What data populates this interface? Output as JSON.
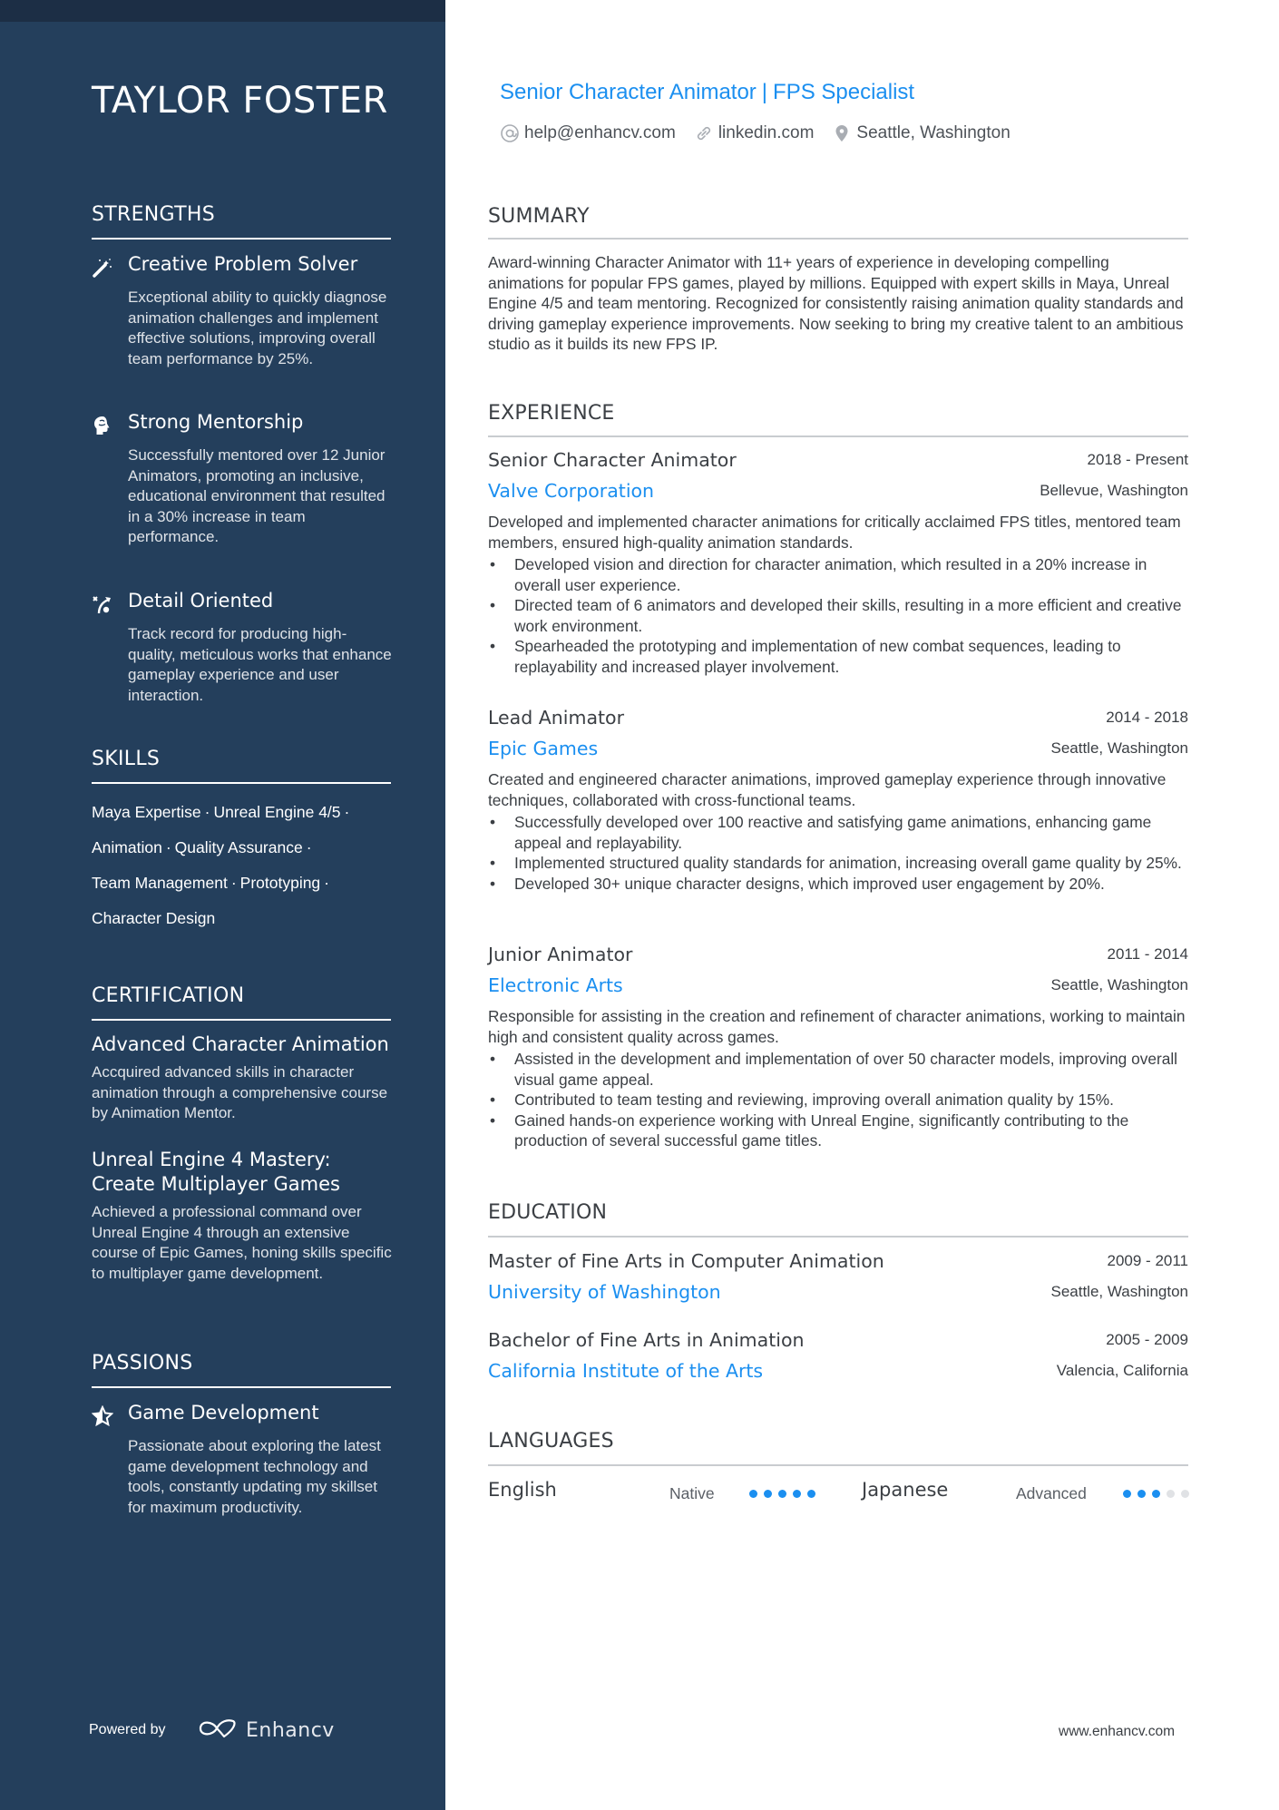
{
  "profile": {
    "name": "TAYLOR FOSTER",
    "headline": "Senior Character Animator",
    "headline_separator": "|",
    "headline_specialty": "FPS Specialist",
    "contacts": [
      {
        "icon": "at-icon",
        "text": "help@enhancv.com"
      },
      {
        "icon": "link-icon",
        "text": "linkedin.com"
      },
      {
        "icon": "location-pin-icon",
        "text": "Seattle, Washington"
      }
    ]
  },
  "colors": {
    "sidebar": "#243f5c",
    "sidebar_top": "#1c2e45",
    "accent": "#1b8ff0",
    "rule": "#c9ccd0"
  },
  "sidebar": {
    "strengths": {
      "heading": "STRENGTHS",
      "items": [
        {
          "icon": "magic-wand-icon",
          "title": "Creative Problem Solver",
          "desc": "Exceptional ability to quickly diagnose animation challenges and implement effective solutions, improving overall team performance by 25%."
        },
        {
          "icon": "head-brain-icon",
          "title": "Strong Mentorship",
          "desc": "Successfully mentored over 12 Junior Animators, promoting an inclusive, educational environment that resulted in a 30% increase in team performance."
        },
        {
          "icon": "strategy-icon",
          "title": "Detail Oriented",
          "desc": "Track record for producing high-quality, meticulous works that enhance gameplay experience and user interaction."
        }
      ]
    },
    "skills": {
      "heading": "SKILLS",
      "items": [
        "Maya Expertise",
        "Unreal Engine 4/5",
        "Animation",
        "Quality Assurance",
        "Team Management",
        "Prototyping",
        "Character Design"
      ],
      "separator": "·"
    },
    "certification": {
      "heading": "CERTIFICATION",
      "items": [
        {
          "title": "Advanced Character Animation",
          "desc": "Accquired advanced skills in character animation through a comprehensive course by Animation Mentor."
        },
        {
          "title": "Unreal Engine 4 Mastery: Create Multiplayer Games",
          "desc": "Achieved a professional command over Unreal Engine 4 through an extensive course of Epic Games, honing skills specific to multiplayer game development."
        }
      ]
    },
    "passions": {
      "heading": "PASSIONS",
      "items": [
        {
          "icon": "star-icon",
          "title": "Game Development",
          "desc": "Passionate about exploring the latest game development technology and tools, constantly updating my skillset for maximum productivity."
        }
      ]
    },
    "footer": {
      "powered_by": "Powered by",
      "brand": "Enhancv"
    }
  },
  "main": {
    "summary": {
      "heading": "SUMMARY",
      "text": "Award-winning Character Animator with 11+ years of experience in developing compelling animations for popular FPS games, played by millions. Equipped with expert skills in Maya, Unreal Engine 4/5 and team mentoring. Recognized for consistently raising animation quality standards and driving gameplay experience improvements. Now seeking to bring my creative talent to an ambitious studio as it builds its new FPS IP."
    },
    "experience": {
      "heading": "EXPERIENCE",
      "items": [
        {
          "title": "Senior Character Animator",
          "dates": "2018 - Present",
          "company": "Valve Corporation",
          "location": "Bellevue, Washington",
          "desc": "Developed and implemented character animations for critically acclaimed FPS titles, mentored team members, ensured high-quality animation standards.",
          "bullets": [
            "Developed vision and direction for character animation, which resulted in a 20% increase in overall user experience.",
            "Directed team of 6 animators and developed their skills, resulting in a more efficient and creative work environment.",
            "Spearheaded the prototyping and implementation of new combat sequences, leading to replayability and increased player involvement."
          ]
        },
        {
          "title": "Lead Animator",
          "dates": "2014 - 2018",
          "company": "Epic Games",
          "location": "Seattle, Washington",
          "desc": "Created and engineered character animations, improved gameplay experience through innovative techniques, collaborated with cross-functional teams.",
          "bullets": [
            "Successfully developed over 100 reactive and satisfying game animations, enhancing game appeal and replayability.",
            "Implemented structured quality standards for animation, increasing overall game quality by 25%.",
            "Developed 30+ unique character designs, which improved user engagement by 20%."
          ]
        },
        {
          "title": "Junior Animator",
          "dates": "2011 - 2014",
          "company": "Electronic Arts",
          "location": "Seattle, Washington",
          "desc": "Responsible for assisting in the creation and refinement of character animations, working to maintain high and consistent quality across games.",
          "bullets": [
            "Assisted in the development and implementation of over 50 character models, improving overall visual game appeal.",
            "Contributed to team testing and reviewing, improving overall animation quality by 15%.",
            "Gained hands-on experience working with Unreal Engine, significantly contributing to the production of several successful game titles."
          ]
        }
      ]
    },
    "education": {
      "heading": "EDUCATION",
      "items": [
        {
          "degree": "Master of Fine Arts in Computer Animation",
          "dates": "2009 - 2011",
          "school": "University of Washington",
          "location": "Seattle, Washington"
        },
        {
          "degree": "Bachelor of Fine Arts in Animation",
          "dates": "2005 - 2009",
          "school": "California Institute of the Arts",
          "location": "Valencia, California"
        }
      ]
    },
    "languages": {
      "heading": "LANGUAGES",
      "items": [
        {
          "name": "English",
          "level": "Native",
          "rating": 5,
          "max": 5
        },
        {
          "name": "Japanese",
          "level": "Advanced",
          "rating": 3,
          "max": 5
        }
      ]
    },
    "footer_site": "www.enhancv.com"
  }
}
